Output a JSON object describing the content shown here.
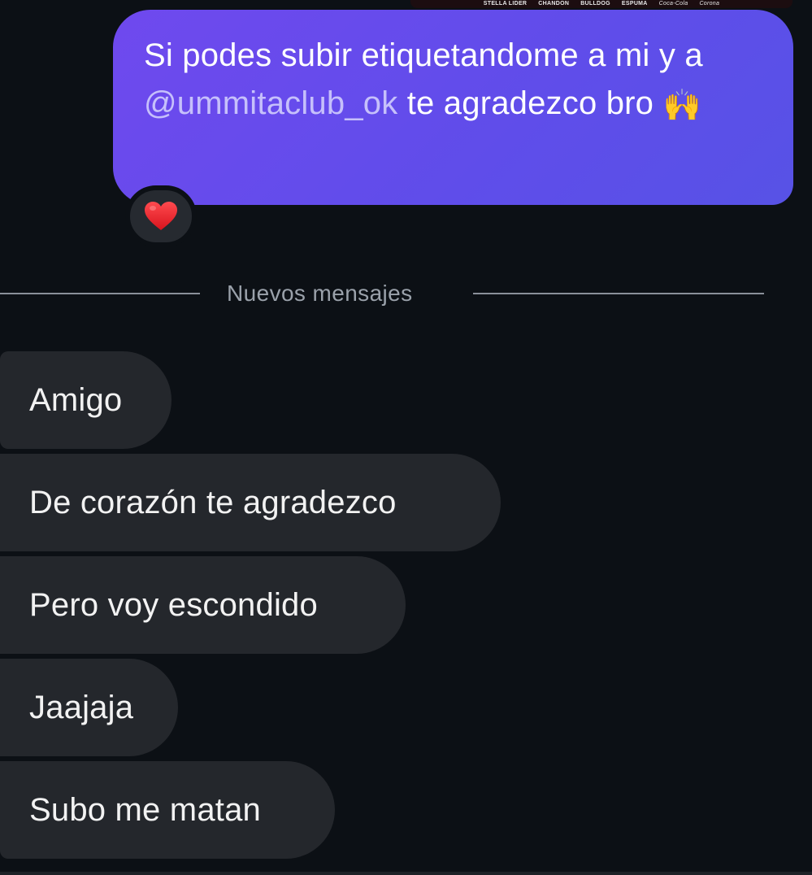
{
  "top_strip": {
    "logos": [
      "STELLA LIDER",
      "CHANDON",
      "BULLDOG",
      "ESPUMA",
      "Coca-Cola",
      "Corona"
    ]
  },
  "outgoing": {
    "text_before_mention": "Si podes subir etiquetandome a mi y a ",
    "mention": "@ummitaclub_ok",
    "text_after_mention": " te agradezco bro ",
    "emoji": "🙌",
    "bubble_color": "#6249ec"
  },
  "reaction": {
    "icon": "red-heart-icon",
    "color": "#e8202a"
  },
  "divider": {
    "label": "Nuevos mensajes"
  },
  "incoming": {
    "messages": [
      {
        "text": "Amigo"
      },
      {
        "text": "De corazón te agradezco"
      },
      {
        "text": "Pero voy escondido"
      },
      {
        "text": "Jaajaja"
      },
      {
        "text": "Subo me matan"
      }
    ],
    "bubble_color": "#24272c"
  }
}
